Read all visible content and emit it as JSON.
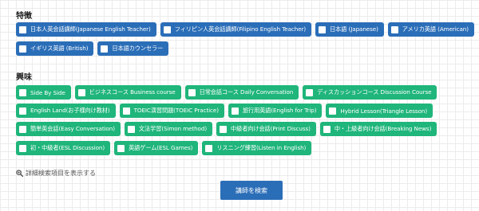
{
  "features": {
    "title": "特徴",
    "rows": [
      [
        "日本人英会話講師(Japanese English Teacher)",
        "フィリピン人英会話講師(Filipino English Teacher)",
        "日本語 (Japanese)",
        "アメリカ英語 (American)"
      ],
      [
        "イギリス英語 (British)",
        "日本語カウンセラー"
      ]
    ]
  },
  "interests": {
    "title": "興味",
    "rows": [
      [
        "Side By Side",
        "ビジネスコース Business course",
        "日常会話コース Daily Conversation",
        "ディスカッションコース Discussion Course"
      ],
      [
        "English Land(お子様向け教材)",
        "TOEIC演習問題(TOEIC Practice)",
        "旅行用英語(English for Trip)",
        "Hybrid Lesson(Triangle Lesson)"
      ],
      [
        "簡単英会話(Easy Conversation)",
        "文法学習(Simon method)",
        "中級者向け会話(Print Discuss)",
        "中・上級者向け会話(Breaking News)"
      ],
      [
        "初・中級者(ESL Discussion)",
        "英語ゲーム(ESL Games)",
        "リスニング練習(Listen in English)"
      ]
    ]
  },
  "detail_link": "詳細検索項目を表示する",
  "search_button": "講師を検索",
  "colors": {
    "feature_tag": "#2b6eb8",
    "interest_tag": "#1fb57b",
    "search_button": "#2b6eb8"
  }
}
